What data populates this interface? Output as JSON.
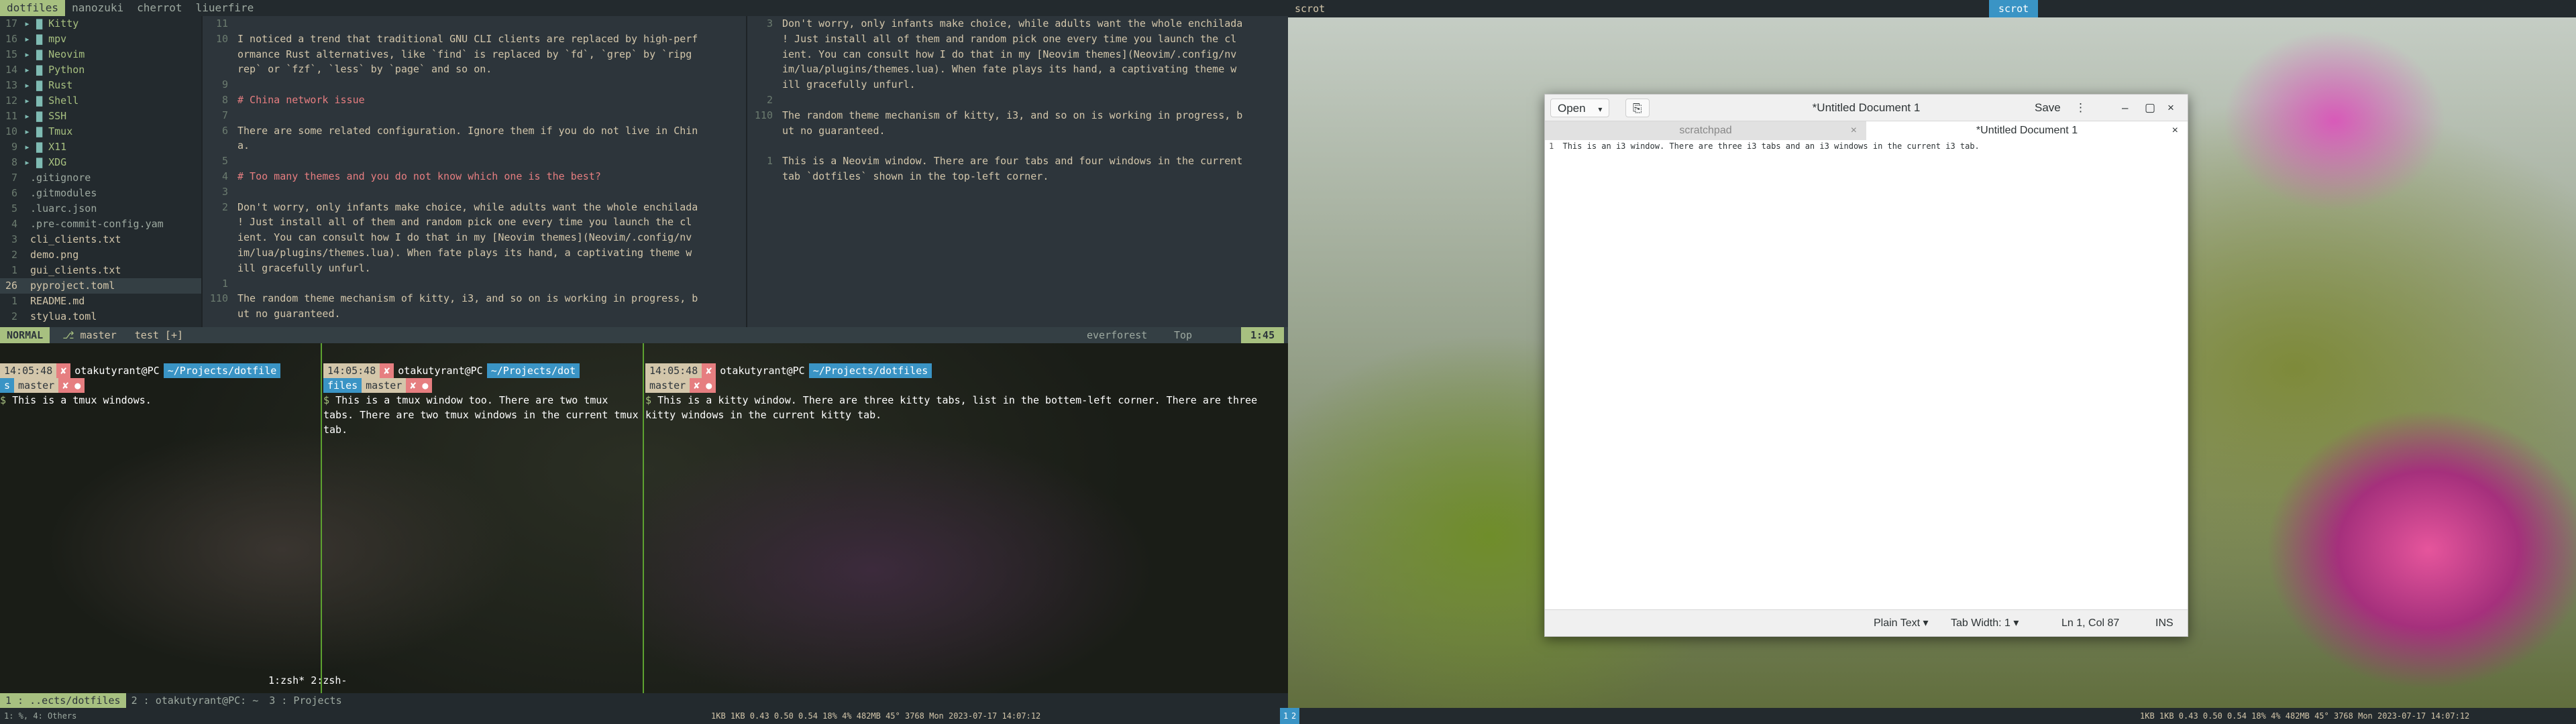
{
  "nvim": {
    "tabs": [
      "dotfiles",
      "nanozuki",
      "cherrot",
      "liuerfire"
    ],
    "tree": [
      {
        "num": "17",
        "label": "Kitty",
        "kind": "dir"
      },
      {
        "num": "16",
        "label": "mpv",
        "kind": "dir"
      },
      {
        "num": "15",
        "label": "Neovim",
        "kind": "dir"
      },
      {
        "num": "14",
        "label": "Python",
        "kind": "dir"
      },
      {
        "num": "13",
        "label": "Rust",
        "kind": "dir"
      },
      {
        "num": "12",
        "label": "Shell",
        "kind": "dir"
      },
      {
        "num": "11",
        "label": "SSH",
        "kind": "dir"
      },
      {
        "num": "10",
        "label": "Tmux",
        "kind": "dir"
      },
      {
        "num": "9",
        "label": "X11",
        "kind": "dir"
      },
      {
        "num": "8",
        "label": "XDG",
        "kind": "dir"
      },
      {
        "num": "7",
        "label": ".gitignore",
        "kind": "file"
      },
      {
        "num": "6",
        "label": ".gitmodules",
        "kind": "file"
      },
      {
        "num": "5",
        "label": ".luarc.json",
        "kind": "file"
      },
      {
        "num": "4",
        "label": ".pre-commit-config.yam",
        "kind": "file"
      },
      {
        "num": "3",
        "label": "cli_clients.txt",
        "kind": "file"
      },
      {
        "num": "2",
        "label": "demo.png",
        "kind": "file"
      },
      {
        "num": "1",
        "label": "gui_clients.txt",
        "kind": "file"
      },
      {
        "num": "26",
        "label": "pyproject.toml",
        "kind": "file"
      },
      {
        "num": "1",
        "label": "README.md",
        "kind": "file"
      },
      {
        "num": "2",
        "label": "stylua.toml",
        "kind": "file"
      }
    ],
    "left_editor": [
      {
        "ln": "11",
        "text": ""
      },
      {
        "ln": "10",
        "text": "I noticed a trend that traditional GNU CLI clients are replaced by high-perf"
      },
      {
        "ln": "",
        "text": "ormance Rust alternatives, like `find` is replaced by `fd`, `grep` by `ripg"
      },
      {
        "ln": "",
        "text": "rep` or `fzf`, `less` by `page` and so on."
      },
      {
        "ln": "9",
        "text": ""
      },
      {
        "ln": "8",
        "text": "# China network issue"
      },
      {
        "ln": "7",
        "text": ""
      },
      {
        "ln": "6",
        "text": "There are some related configuration. Ignore them if you do not live in Chin"
      },
      {
        "ln": "",
        "text": "a."
      },
      {
        "ln": "5",
        "text": ""
      },
      {
        "ln": "4",
        "text": "# Too many themes and you do not know which one is the best?"
      },
      {
        "ln": "3",
        "text": ""
      },
      {
        "ln": "2",
        "text": "Don't worry, only infants make choice, while adults want the whole enchilada"
      },
      {
        "ln": "",
        "text": "! Just install all of them and random pick one every time you launch the cl"
      },
      {
        "ln": "",
        "text": "ient. You can consult how I do that in my [Neovim themes](Neovim/.config/nv"
      },
      {
        "ln": "",
        "text": "im/lua/plugins/themes.lua). When fate plays its hand, a captivating theme w"
      },
      {
        "ln": "",
        "text": "ill gracefully unfurl."
      },
      {
        "ln": "1",
        "text": ""
      },
      {
        "ln": "110",
        "text": "The random theme mechanism of kitty, i3, and so on is working in progress, b"
      },
      {
        "ln": "",
        "text": "ut no guaranteed."
      }
    ],
    "right_editor": [
      {
        "ln": "3",
        "text": "Don't worry, only infants make choice, while adults want the whole enchilada"
      },
      {
        "ln": "",
        "text": "! Just install all of them and random pick one every time you launch the cl"
      },
      {
        "ln": "",
        "text": "ient. You can consult how I do that in my [Neovim themes](Neovim/.config/nv"
      },
      {
        "ln": "",
        "text": "im/lua/plugins/themes.lua). When fate plays its hand, a captivating theme w"
      },
      {
        "ln": "",
        "text": "ill gracefully unfurl."
      },
      {
        "ln": "2",
        "text": ""
      },
      {
        "ln": "110",
        "text": "The random theme mechanism of kitty, i3, and so on is working in progress, b"
      },
      {
        "ln": "",
        "text": "ut no guaranteed."
      },
      {
        "ln": "",
        "text": ""
      },
      {
        "ln": "1",
        "text": "This is a Neovim window. There are four tabs and four windows in the current"
      },
      {
        "ln": "",
        "text": "tab `dotfiles` shown in the top-left corner."
      }
    ],
    "status": {
      "mode": "NORMAL",
      "branch": "master",
      "test": "test [+]",
      "theme": "everforest",
      "pos_word": "Top",
      "pos": "1:45"
    }
  },
  "tmux": {
    "panes": [
      {
        "time": "14:05:48",
        "user": "otakutyrant@PC",
        "dir": "~/Projects/dotfile",
        "dir2": "s",
        "branch": "master",
        "cmd": "This is a tmux windows."
      },
      {
        "time": "14:05:48",
        "user": "otakutyrant@PC",
        "dir": "~/Projects/dot",
        "dir2": "files",
        "branch": "master",
        "cmd": "This is a tmux window too. There are two tmux tabs. There are two tmux windows in the current tmux tab."
      },
      {
        "time": "14:05:48",
        "user": "otakutyrant@PC",
        "dir": "~/Projects/dotfiles",
        "dir2": "",
        "branch": "master",
        "cmd": "This is a kitty window. There are three kitty tabs, list in the bottem-left corner. There are three kitty windows in the current kitty tab."
      }
    ],
    "windows_label": "1:zsh* 2:zsh-",
    "kitty_tabs": [
      "1 : ..ects/dotfiles",
      "2 : otakutyrant@PC: ~",
      "3 : Projects"
    ]
  },
  "i3": {
    "left_input": "scrot",
    "right_input": "scrot",
    "workspace": "scrot",
    "status_left": "1KB   1KB  0.43 0.50 0.54   18%   4% 482MB 45°   3768   Mon 2023-07-17 14:07:12",
    "status_right": "1KB   1KB  0.43 0.50 0.54   18%   4% 482MB 45°   3768   Mon 2023-07-17 14:07:12",
    "ws_left": "1",
    "ws_right": "2",
    "bottom_left_hint": "1: %, 4: Others"
  },
  "gedit": {
    "open_label": "Open",
    "title": "*Untitled Document 1",
    "save_label": "Save",
    "tabs": [
      "scratchpad",
      "*Untitled Document 1"
    ],
    "line_num": "1",
    "content": "This is an i3 window. There are three i3 tabs and an i3 windows in the current i3 tab.",
    "status": {
      "lang": "Plain Text",
      "tabwidth": "Tab Width: 1",
      "cursor": "Ln 1, Col 87",
      "mode": "INS"
    }
  }
}
